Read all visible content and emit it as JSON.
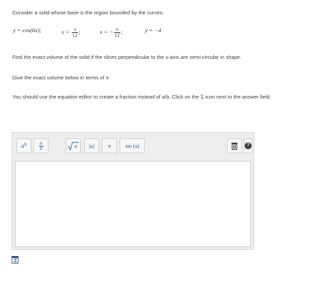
{
  "problem": {
    "intro": "Consider a solid whose base is the region bounded by the curves:",
    "curves": {
      "c1": "y = cos(6x);",
      "c2_lhs": "x = ",
      "c2_num": "π",
      "c2_den": "12",
      "c2_tail": ";",
      "c3_lhs": "x = −",
      "c3_num": "π",
      "c3_den": "12",
      "c3_tail": ";",
      "c4": "y = −4"
    },
    "question_pre": "Find the exact volume of the solid if the slices perpendicular to the ",
    "question_var": "x",
    "question_post": "-axis are semi-circular in shape.",
    "instruction_pre": "Give the exact volume below in terms of ",
    "instruction_pi": "π",
    "instruction_post": ".",
    "editor_note_pre": "You should use the equation editor to create a fraction instead of a/b. Click on the ",
    "editor_note_sigma": "Σ",
    "editor_note_post": " icon next to the answer field."
  },
  "toolbar": {
    "exponent": {
      "base": "a",
      "sup": "b"
    },
    "fraction": {
      "num": "a",
      "den": "b"
    },
    "sqrt": {
      "radicand": "a"
    },
    "abs": "|a|",
    "pi": "π",
    "sin": "sin (a)",
    "help": "?"
  },
  "icons": {
    "trash": "trash-icon",
    "help": "help-icon",
    "equation_editor": "equation-editor-icon"
  },
  "colors": {
    "toolbar_accent": "#2a5d9f",
    "help_bg": "#3a3a3a"
  }
}
